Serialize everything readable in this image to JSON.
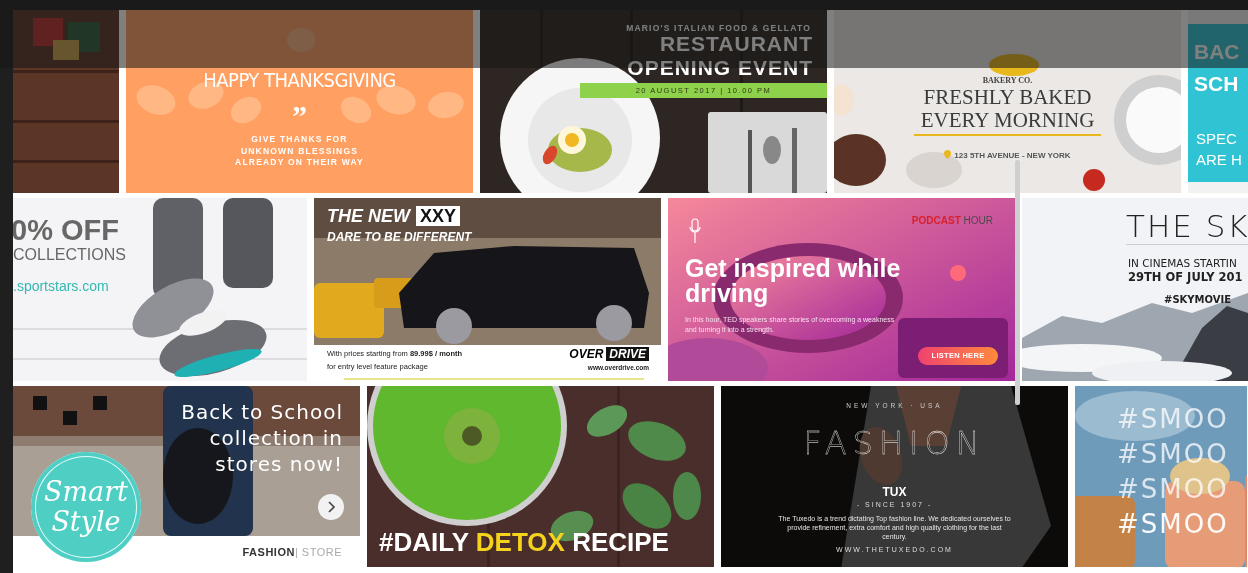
{
  "rows": [
    {
      "tiles": [
        {
          "kind": "gifts"
        },
        {
          "kind": "thanksgiving",
          "title": "HAPPY THANKSGIVING",
          "quote": "”",
          "message": "GIVE THANKS FOR\nUNKNOWN BLESSINGS\nALREADY ON THEIR WAY"
        },
        {
          "kind": "restaurant",
          "tagline": "MARIO'S ITALIAN FOOD & GELLATO",
          "title": "RESTAURANT\nOPENING EVENT",
          "date": "20 AUGUST 2017 | 10.00 PM"
        },
        {
          "kind": "bakery",
          "brand": "BAKERY CO.",
          "title": "FRESHLY BAKED\nEVERY MORNING",
          "address": "123 5TH AVENUE - NEW YORK"
        },
        {
          "kind": "school",
          "title": "BAC\nSCH",
          "subtitle": "SPEC\nARE H"
        }
      ]
    },
    {
      "tiles": [
        {
          "kind": "sneakers",
          "headline": "0% OFF",
          "subline": "COLLECTIONS",
          "url": ".sportstars.com"
        },
        {
          "kind": "car",
          "title": "THE NEW",
          "badge": "XXY",
          "tagline": "DARE TO BE DIFFERENT",
          "price": "With prices starting from **89.99$ / month**",
          "note": "for entry level feature package",
          "logo_left": "OVER",
          "logo_right": "DRIVE",
          "url": "www.overdrive.com"
        },
        {
          "kind": "podcast",
          "brand": "**PODCAST** HOUR",
          "title": "Get inspired while driving",
          "body": "In this hour, TED speakers share stories of overcoming a weakness and turning it into a strength.",
          "button": "LISTEN HERE"
        },
        {
          "kind": "sky",
          "title": "THE SK",
          "line1": "IN CINEMAS STARTIN",
          "line2": "29TH OF JULY 201",
          "tag": "#SKYMOVIE"
        }
      ]
    },
    {
      "tiles": [
        {
          "kind": "smartstyle",
          "logo": "Smart\nStyle",
          "headline": "Back to School\ncollection in\nstores now!",
          "brand": "**FASHION**| STORE"
        },
        {
          "kind": "detox",
          "headline": "#DAILY **DETOX** RECIPE"
        },
        {
          "kind": "fashion",
          "location": "NEW YORK · USA",
          "title": "FASHION",
          "logo": "TUX",
          "since": "- SINCE 1907 -",
          "body": "The Tuxedo is a trend dictating Top fashion line. We dedicated ourselves to provide refinement, extra comfort and high quality clothing for the last century.",
          "url": "WWW.THETUXEDO.COM"
        },
        {
          "kind": "smoothie",
          "lines": [
            "#SMOO",
            "#SMOO",
            "#SMOO",
            "#SMOO"
          ]
        }
      ]
    }
  ]
}
